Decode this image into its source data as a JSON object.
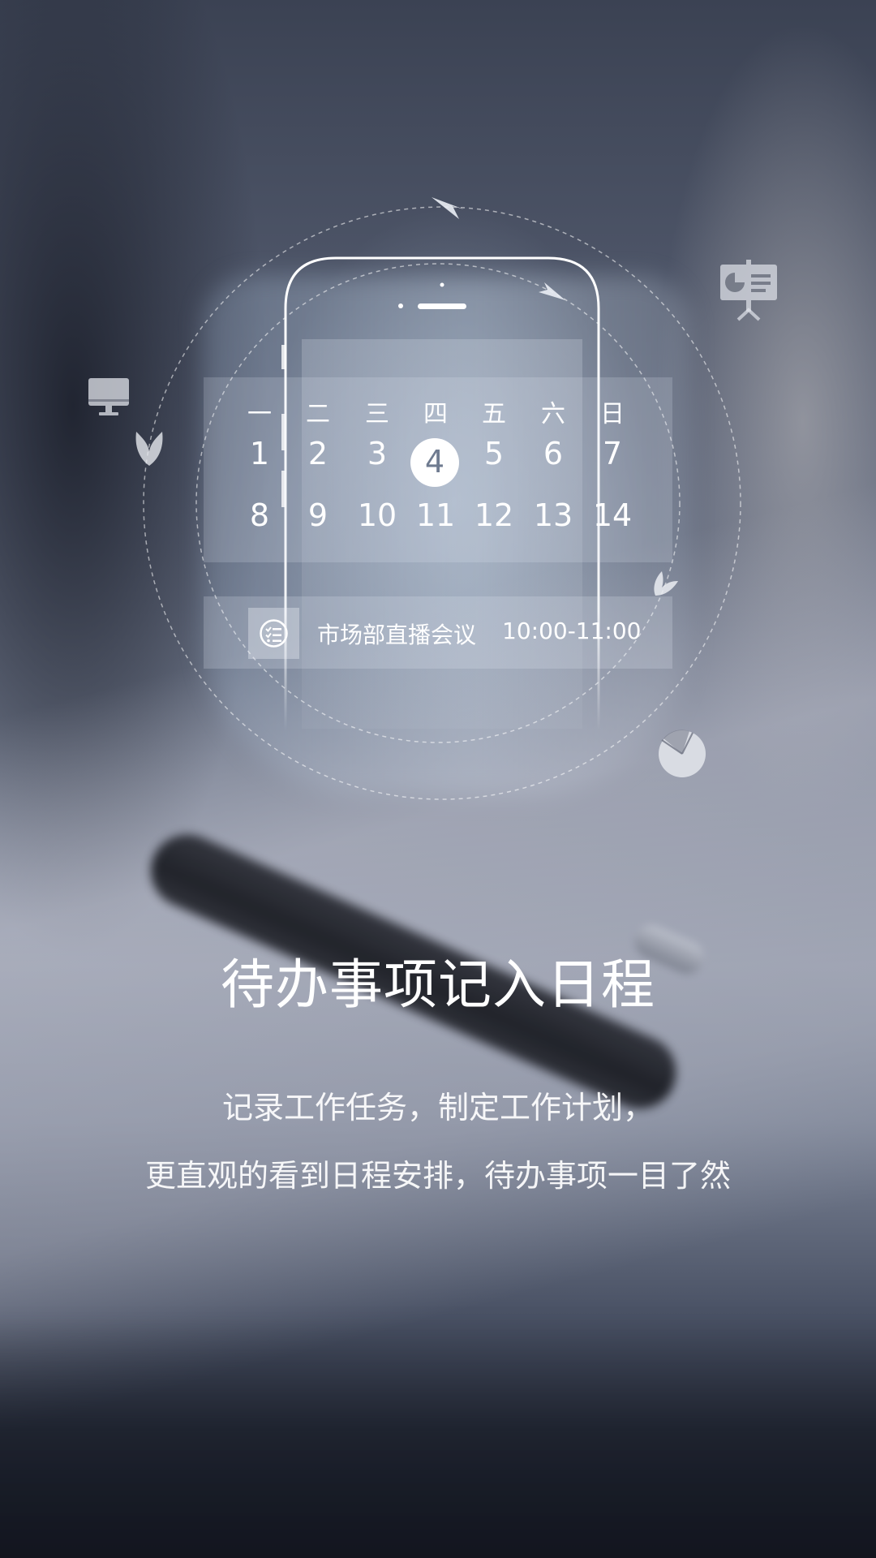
{
  "calendar": {
    "weekdays": [
      "一",
      "二",
      "三",
      "四",
      "五",
      "六",
      "日"
    ],
    "week1": [
      "1",
      "2",
      "3",
      "4",
      "5",
      "6",
      "7"
    ],
    "week2": [
      "8",
      "9",
      "10",
      "11",
      "12",
      "13",
      "14"
    ],
    "selected_day": "4"
  },
  "event": {
    "icon": "checklist-icon",
    "title": "市场部直播会议",
    "time": "10:00-11:00"
  },
  "decor_icons": [
    "monitor-icon",
    "presentation-board-icon",
    "pie-chart-icon",
    "leaf-icon",
    "sync-arrows-icon",
    "phone-outline"
  ],
  "headline": "待办事项记入日程",
  "description": {
    "line1": "记录工作任务，制定工作计划，",
    "line2": "更直观的看到日程安排，待办事项一目了然"
  },
  "colors": {
    "text": "#ffffff",
    "selected_day_fill": "#ffffff",
    "selected_day_text": "#6f7b90",
    "panel": "rgba(235,240,248,0.18)"
  }
}
